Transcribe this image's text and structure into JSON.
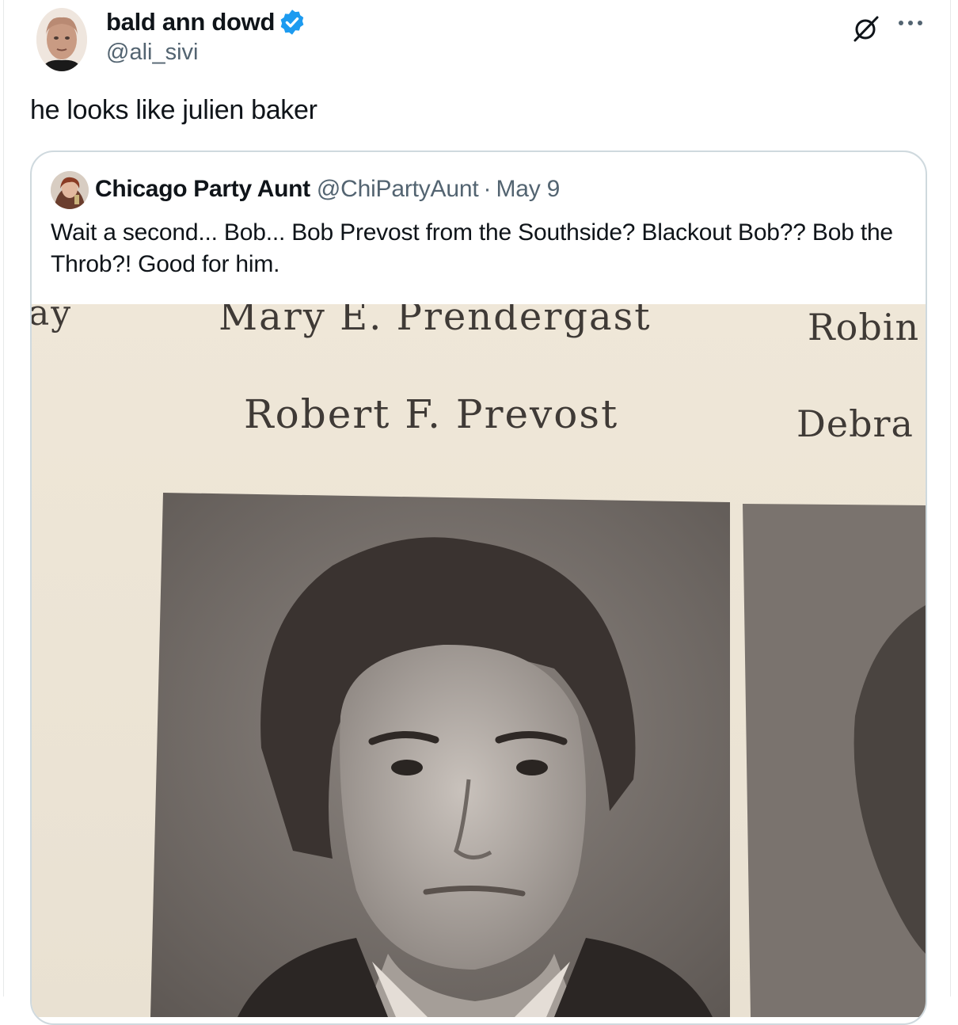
{
  "post": {
    "author_name": "bald ann dowd",
    "author_handle": "@ali_sivi",
    "verified_color": "#1d9bf0",
    "text": "he looks like julien baker",
    "icons": [
      "grok-icon",
      "more-icon"
    ]
  },
  "quote": {
    "author_name": "Chicago Party Aunt",
    "author_handle": "@ChiPartyAunt",
    "separator": "·",
    "date": "May 9",
    "text": "Wait a second... Bob... Bob Prevost from the Southside? Blackout Bob?? Bob the Throb?! Good for him."
  },
  "photo": {
    "labels": {
      "top_left_partial": "ay",
      "top_center": "Mary E. Prendergast",
      "top_right_partial": "Robin",
      "middle_center": "Robert F. Prevost",
      "middle_right_partial": "Debra"
    }
  },
  "colors": {
    "text_primary": "#0f1419",
    "text_secondary": "#536471",
    "border": "#cfd9de",
    "accent": "#1d9bf0"
  }
}
